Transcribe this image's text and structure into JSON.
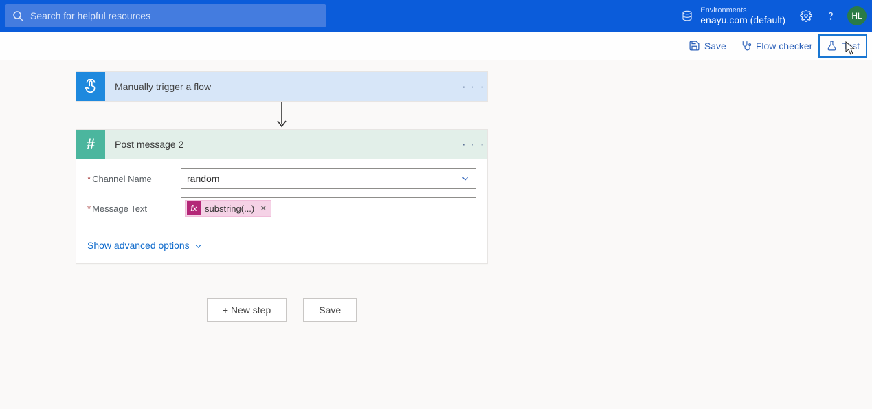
{
  "header": {
    "search_placeholder": "Search for helpful resources",
    "environments_label": "Environments",
    "environment_value": "enayu.com (default)",
    "avatar_initials": "HL"
  },
  "actionbar": {
    "save_label": "Save",
    "flow_checker_label": "Flow checker",
    "test_label": "Test"
  },
  "flow": {
    "trigger": {
      "title": "Manually trigger a flow"
    },
    "action": {
      "title": "Post message 2",
      "fields": {
        "channel": {
          "label": "Channel Name",
          "value": "random"
        },
        "message": {
          "label": "Message Text",
          "token": "substring(...)"
        }
      },
      "advanced_label": "Show advanced options"
    },
    "bottom": {
      "new_step_label": "+ New step",
      "save_label": "Save"
    }
  }
}
